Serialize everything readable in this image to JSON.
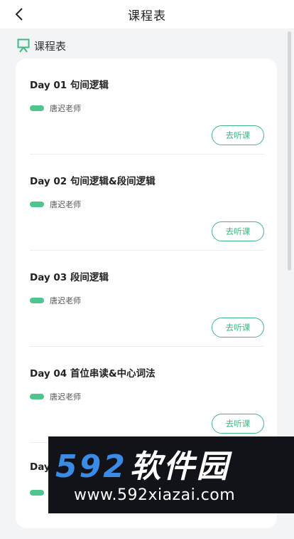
{
  "header": {
    "title": "课程表"
  },
  "section": {
    "title": "课程表"
  },
  "lessons": [
    {
      "title": "Day 01 句间逻辑",
      "teacher": "唐迟老师",
      "button": "去听课"
    },
    {
      "title": "Day 02 句间逻辑&段间逻辑",
      "teacher": "唐迟老师",
      "button": "去听课"
    },
    {
      "title": "Day 03 段间逻辑",
      "teacher": "唐迟老师",
      "button": "去听课"
    },
    {
      "title": "Day 04 首位串读&中心词法",
      "teacher": "唐迟老师",
      "button": "去听课"
    },
    {
      "title": "Day",
      "teacher": "",
      "button": ""
    }
  ],
  "watermark": {
    "logo_number": "592",
    "logo_text": "软件园",
    "url": "www.592xiazai.com"
  },
  "colors": {
    "accent": "#3fb983",
    "background": "#f3f4f6",
    "watermark_blue": "#3a8be6"
  }
}
